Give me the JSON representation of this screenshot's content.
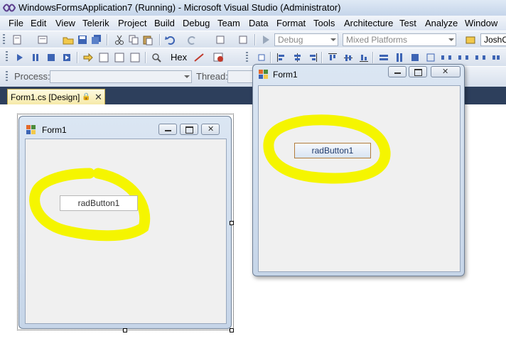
{
  "window": {
    "title": "WindowsFormsApplication7 (Running) - Microsoft Visual Studio (Administrator)"
  },
  "menu": [
    "File",
    "Edit",
    "View",
    "Telerik",
    "Project",
    "Build",
    "Debug",
    "Team",
    "Data",
    "Format",
    "Tools",
    "Architecture",
    "Test",
    "Analyze",
    "Window"
  ],
  "toolbar": {
    "config_combo": "Debug",
    "platform_combo": "Mixed Platforms",
    "user_box": "JoshC",
    "hex_label": "Hex"
  },
  "debug_location": {
    "process_label": "Process:",
    "thread_label": "Thread:"
  },
  "tab": {
    "label": "Form1.cs [Design]"
  },
  "design_form": {
    "title": "Form1",
    "button_label": "radButton1"
  },
  "running_form": {
    "title": "Form1",
    "button_label": "radButton1"
  },
  "colors": {
    "highlight": "#f5f500",
    "tab_strip": "#2d3f5c",
    "tab_active": "#f6e9a8"
  }
}
